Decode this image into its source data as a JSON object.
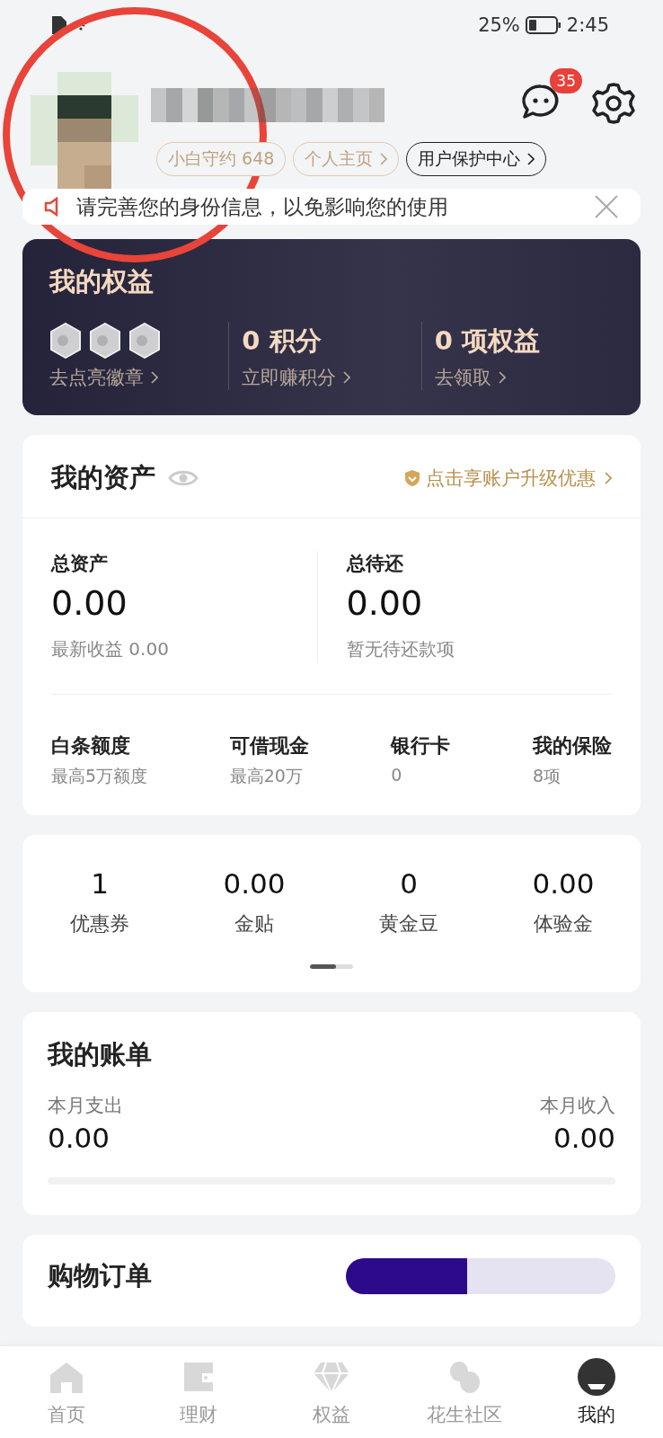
{
  "status_bar": {
    "battery": "25%",
    "time": "2:45"
  },
  "profile": {
    "pills": [
      {
        "label": "小白守约 648",
        "kind": "gold"
      },
      {
        "label": "个人主页",
        "kind": "gold"
      },
      {
        "label": "用户保护中心",
        "kind": "dark"
      }
    ],
    "message_count": "35"
  },
  "annotation": {
    "kind": "circle"
  },
  "notice": {
    "text": "请完善您的身份信息，以免影响您的使用"
  },
  "rights": {
    "title": "我的权益",
    "items": [
      {
        "kind": "badges",
        "link": "去点亮徽章"
      },
      {
        "kind": "stat",
        "value": "0",
        "unit": "积分",
        "link": "立即赚积分"
      },
      {
        "kind": "stat",
        "value": "0",
        "unit": "项权益",
        "link": "去领取"
      }
    ]
  },
  "assets": {
    "title": "我的资产",
    "promo": "点击享账户升级优惠",
    "totals": [
      {
        "label": "总资产",
        "value": "0.00",
        "note": "最新收益 0.00"
      },
      {
        "label": "总待还",
        "value": "0.00",
        "note": "暂无待还款项"
      }
    ],
    "products": [
      {
        "label": "白条额度",
        "note": "最高5万额度"
      },
      {
        "label": "可借现金",
        "note": "最高20万"
      },
      {
        "label": "银行卡",
        "note": "0"
      },
      {
        "label": "我的保险",
        "note": "8项"
      }
    ]
  },
  "wallet": {
    "items": [
      {
        "value": "1",
        "label": "优惠券"
      },
      {
        "value": "0.00",
        "label": "金贴"
      },
      {
        "value": "0",
        "label": "黄金豆"
      },
      {
        "value": "0.00",
        "label": "体验金"
      }
    ]
  },
  "bill": {
    "title": "我的账单",
    "spend_label": "本月支出",
    "spend": "0.00",
    "income_label": "本月收入",
    "income": "0.00"
  },
  "orders": {
    "title": "购物订单"
  },
  "tabs": [
    {
      "label": "首页",
      "kind": "home",
      "selected": false
    },
    {
      "label": "理财",
      "kind": "wallet",
      "selected": false
    },
    {
      "label": "权益",
      "kind": "diamond",
      "selected": false
    },
    {
      "label": "花生社区",
      "kind": "peanut",
      "selected": false
    },
    {
      "label": "我的",
      "kind": "avatar",
      "selected": true
    }
  ]
}
